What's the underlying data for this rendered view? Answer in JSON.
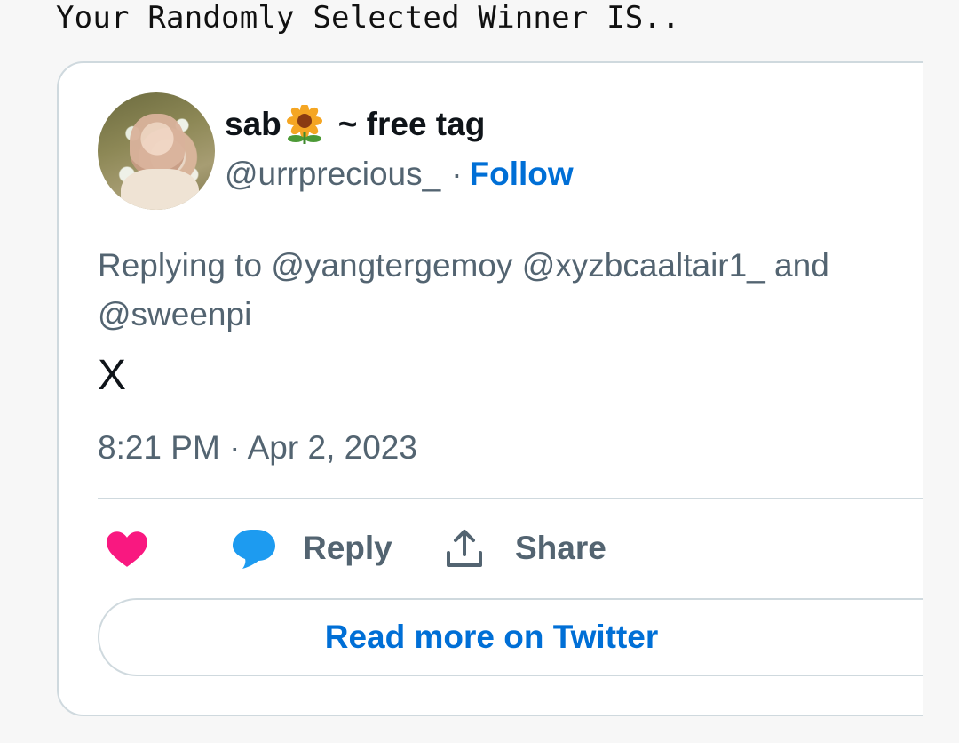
{
  "page": {
    "headline": "Your Randomly Selected Winner IS.."
  },
  "tweet": {
    "display_name": "sab",
    "name_suffix": "~ free tag",
    "name_emoji": "sunflower-icon",
    "handle": "@urrprecious_",
    "separator": "·",
    "follow_label": "Follow",
    "replying_to": "Replying to @yangtergemoy @xyzbcaaltair1_ and @sweenpi",
    "text": "X",
    "timestamp": "8:21 PM · Apr 2, 2023"
  },
  "actions": {
    "like_icon": "heart-icon",
    "reply_label": "Reply",
    "share_label": "Share"
  },
  "footer": {
    "read_more_label": "Read more on Twitter"
  },
  "colors": {
    "link_blue": "#006fd6",
    "heart_pink": "#f91880",
    "reply_blue": "#1d9bf0",
    "muted_text": "#536471"
  }
}
